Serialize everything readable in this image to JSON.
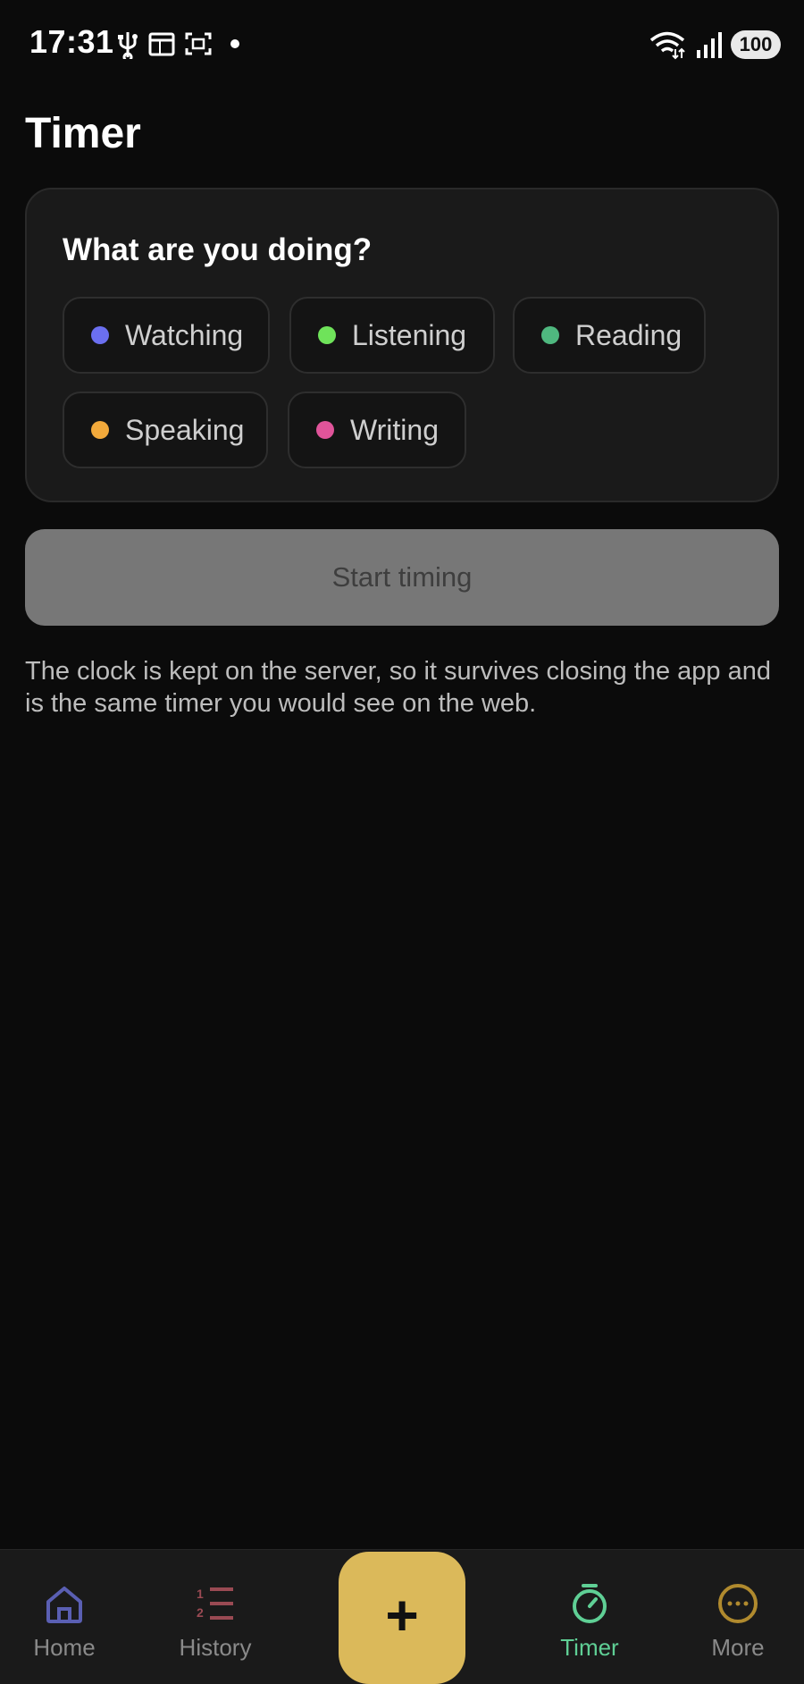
{
  "status_bar": {
    "time": "17:31",
    "battery": "100",
    "icons": [
      "usb-icon",
      "calendar-icon",
      "screenshot-icon",
      "dot-icon",
      "wifi-icon",
      "signal-icon",
      "battery-icon"
    ]
  },
  "page": {
    "title": "Timer"
  },
  "activity_card": {
    "heading": "What are you doing?",
    "options": [
      {
        "label": "Watching",
        "color": "#6b6ff0"
      },
      {
        "label": "Listening",
        "color": "#6fe35a"
      },
      {
        "label": "Reading",
        "color": "#4fb87f"
      },
      {
        "label": "Speaking",
        "color": "#f2a93b"
      },
      {
        "label": "Writing",
        "color": "#e0549a"
      }
    ]
  },
  "start_button": {
    "label": "Start timing",
    "enabled": false
  },
  "info_text": "The clock is kept on the server, so it survives closing the app and is the same timer you would see on the web.",
  "bottom_nav": {
    "items": [
      {
        "label": "Home",
        "icon": "home-icon",
        "color": "#5a5fb3"
      },
      {
        "label": "History",
        "icon": "ordered-list-icon",
        "color": "#9a4a53"
      },
      {
        "label": "Timer",
        "icon": "stopwatch-icon",
        "color": "#5fcf95",
        "active": true
      },
      {
        "label": "More",
        "icon": "more-dots-icon",
        "color": "#b08a2e"
      }
    ],
    "fab": {
      "label": "+",
      "icon": "plus-icon",
      "color": "#dbb95a"
    }
  }
}
